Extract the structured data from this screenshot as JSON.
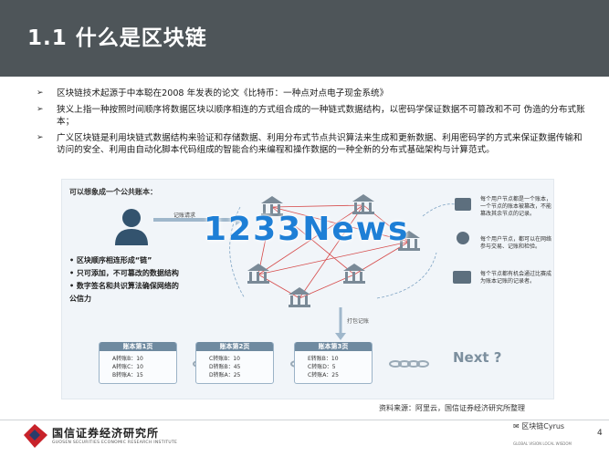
{
  "header": {
    "title": "1.1 什么是区块链"
  },
  "bullets": [
    "区块链技术起源于中本聪在2008 年发表的论文《比特币：一种点对点电子现金系统》",
    "狭义上指一种按照时间顺序将数据区块以顺序相连的方式组合成的一种链式数据结构，以密码学保证数据不可篡改和不可 伪造的分布式账本；",
    "广义区块链是利用块链式数据结构来验证和存储数据、利用分布式节点共识算法来生成和更新数据、利用密码学的方式来保证数据传输和访问的安全、利用由自动化脚本代码组成的智能合约来编程和操作数据的一种全新的分布式基础架构与计算范式。"
  ],
  "diagram": {
    "top_question": "可以想象成一个公共账本：",
    "record_request": "记账请求",
    "watermark": "1233News",
    "left_list": [
      "• 区块顺序相连形成“链”",
      "• 只可添加，不可篡改的数据结构",
      "• 数字签名和共识算法确保网络的",
      "公信力"
    ],
    "record_label": "打包记账",
    "right_notes": [
      "每个用户节点都是一个账本，一个节点的账本被篡改，不能篡改其余节点的记录。",
      "每个用户节点，都可以在网络参与交易、记账和检验。",
      "每个节点都有机会通过比赛成为账本记账的记录者。"
    ],
    "pages": [
      {
        "title": "账本第1页",
        "rows": [
          "A转账B：10",
          "A转账C：10",
          "B转账A：15"
        ]
      },
      {
        "title": "账本第2页",
        "rows": [
          "C转账B：10",
          "D转账B：45",
          "D转账A：25"
        ]
      },
      {
        "title": "账本第3页",
        "rows": [
          "E转账B：10",
          "C转账D：5",
          "C转账A：25"
        ]
      }
    ],
    "next_label": "Next ?"
  },
  "source_note": "资料来源：阿里云，国信证券经济研究所整理",
  "footer": {
    "company_cn": "国信证券经济研究所",
    "company_en": "GUOSEN SECURITIES ECONOMIC RESEARCH INSTITUTE",
    "wechat_label": "区块链Cyrus",
    "global_text": "GLOBAL VISION  LOCAL WISDOM",
    "page_number": "4"
  },
  "colors": {
    "header_bg": "#4e5559",
    "accent_blue": "#1e7fd6",
    "logo_red": "#c8222a"
  }
}
